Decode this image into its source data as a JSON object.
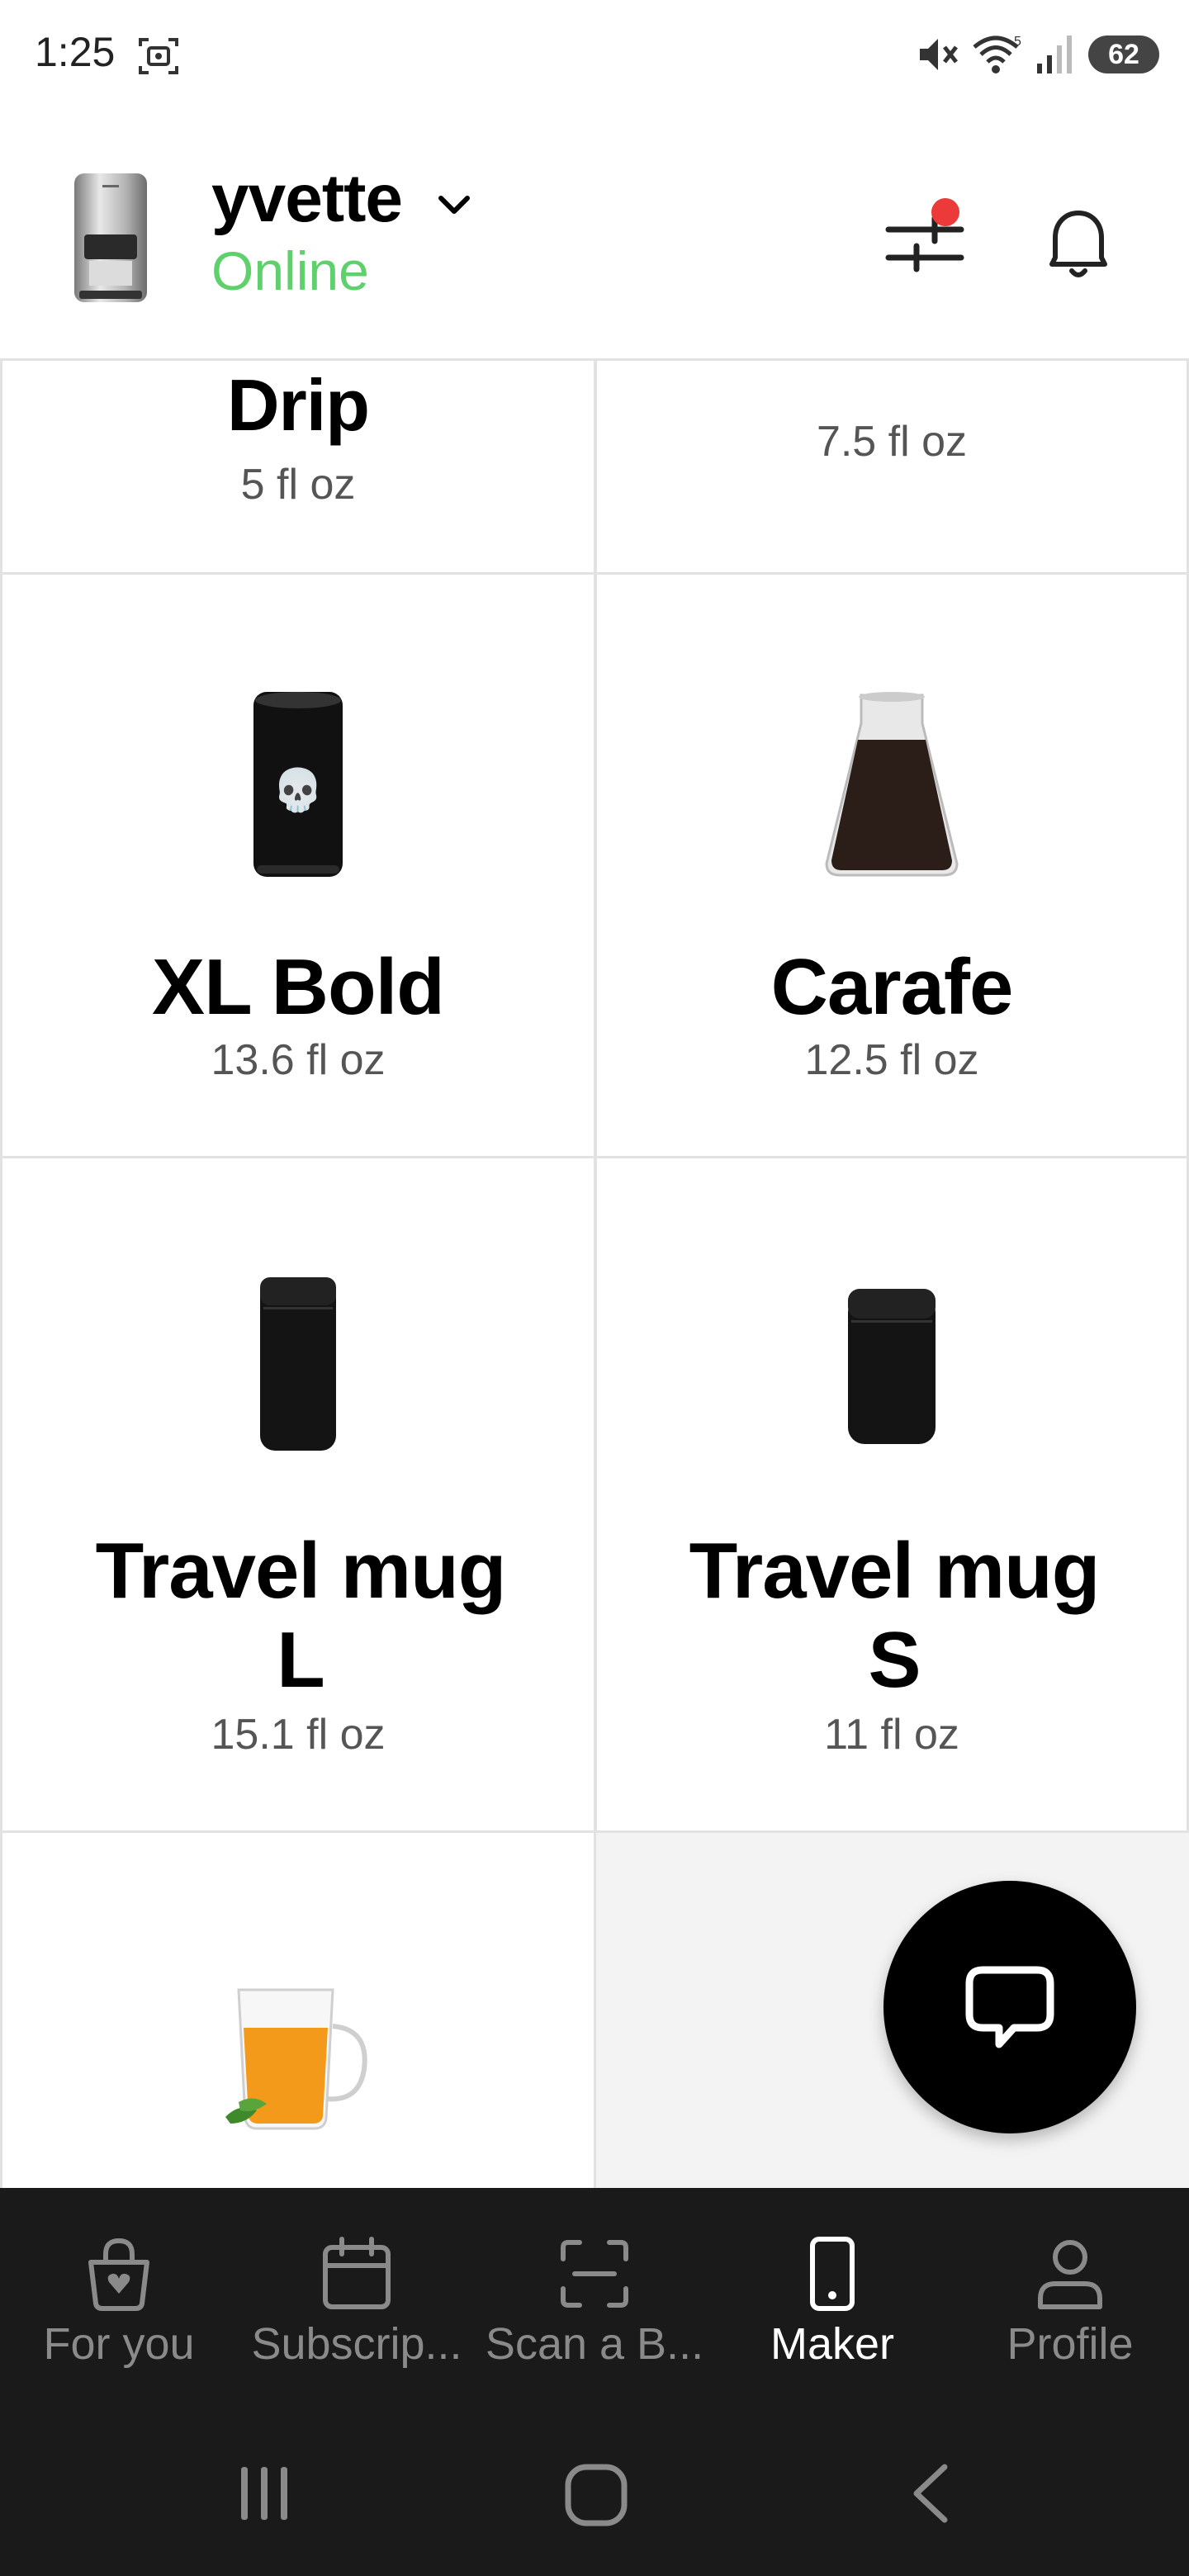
{
  "status_bar": {
    "time": "1:25",
    "battery": "62"
  },
  "header": {
    "maker_name": "yvette",
    "maker_status": "Online"
  },
  "drinks": [
    {
      "name": "Drip",
      "size": "5 fl oz"
    },
    {
      "name": "",
      "size": "7.5 fl oz"
    },
    {
      "name": "XL Bold",
      "size": "13.6 fl oz"
    },
    {
      "name": "Carafe",
      "size": "12.5 fl oz"
    },
    {
      "name": "Travel mug L",
      "size": "15.1 fl oz"
    },
    {
      "name": "Travel mug S",
      "size": "11 fl oz"
    }
  ],
  "bottom_nav": [
    {
      "label": "For you",
      "icon": "bag-heart-icon"
    },
    {
      "label": "Subscrip...",
      "icon": "calendar-icon"
    },
    {
      "label": "Scan a B...",
      "icon": "scan-icon"
    },
    {
      "label": "Maker",
      "icon": "phone-icon",
      "active": true
    },
    {
      "label": "Profile",
      "icon": "person-icon"
    }
  ],
  "colors": {
    "online": "#5fd06c",
    "notification_dot": "#ec3a3a",
    "nav_background": "#1a1a1a"
  }
}
